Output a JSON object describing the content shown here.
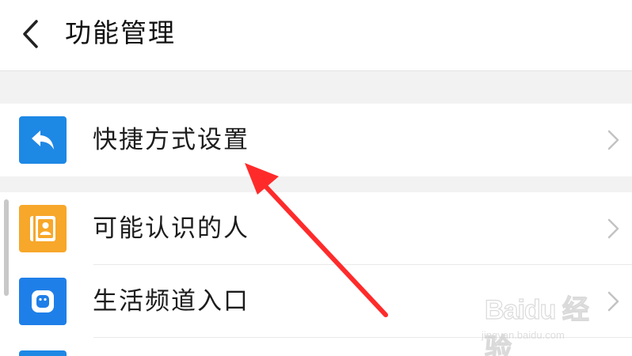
{
  "header": {
    "title": "功能管理",
    "back_icon": "chevron-left-icon"
  },
  "list": {
    "items": [
      {
        "label": "快捷方式设置",
        "icon": "share-reply-icon",
        "icon_color": "#1e88e5"
      },
      {
        "label": "可能认识的人",
        "icon": "contact-card-icon",
        "icon_color": "#f7a72a"
      },
      {
        "label": "生活频道入口",
        "icon": "app-face-icon",
        "icon_color": "#1f7fe8"
      }
    ]
  },
  "annotation": {
    "arrow_color": "#ff2b2b"
  },
  "watermark": {
    "brand": "Baidu 经验",
    "url": "jingyan.baidu.com"
  },
  "colors": {
    "background": "#f2f2f2",
    "row": "#ffffff",
    "text": "#1c1c1c"
  }
}
